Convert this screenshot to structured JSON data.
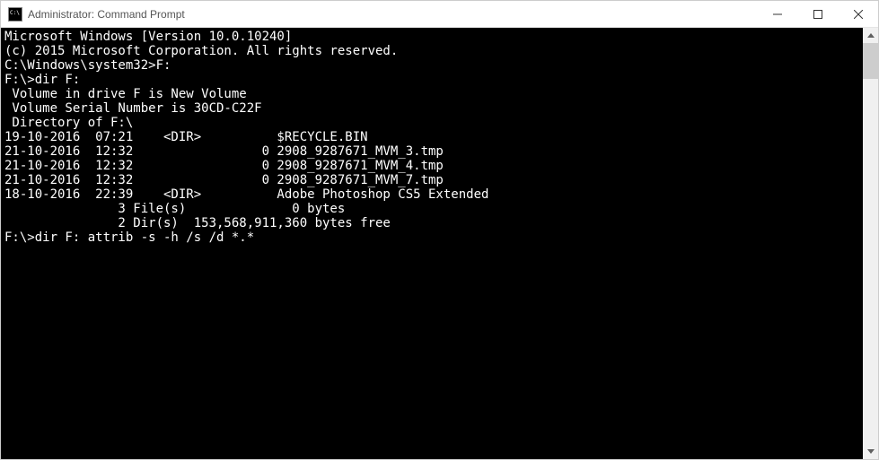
{
  "window": {
    "title": "Administrator: Command Prompt"
  },
  "terminal": {
    "lines": [
      "Microsoft Windows [Version 10.0.10240]",
      "(c) 2015 Microsoft Corporation. All rights reserved.",
      "",
      "C:\\Windows\\system32>F:",
      "",
      "F:\\>dir F:",
      " Volume in drive F is New Volume",
      " Volume Serial Number is 30CD-C22F",
      "",
      " Directory of F:\\",
      "",
      "19-10-2016  07:21    <DIR>          $RECYCLE.BIN",
      "21-10-2016  12:32                 0 2908_9287671_MVM_3.tmp",
      "21-10-2016  12:32                 0 2908_9287671_MVM_4.tmp",
      "21-10-2016  12:32                 0 2908_9287671_MVM_7.tmp",
      "18-10-2016  22:39    <DIR>          Adobe Photoshop CS5 Extended",
      "               3 File(s)              0 bytes",
      "               2 Dir(s)  153,568,911,360 bytes free",
      "",
      "F:\\>dir F: attrib -s -h /s /d *.*"
    ]
  }
}
